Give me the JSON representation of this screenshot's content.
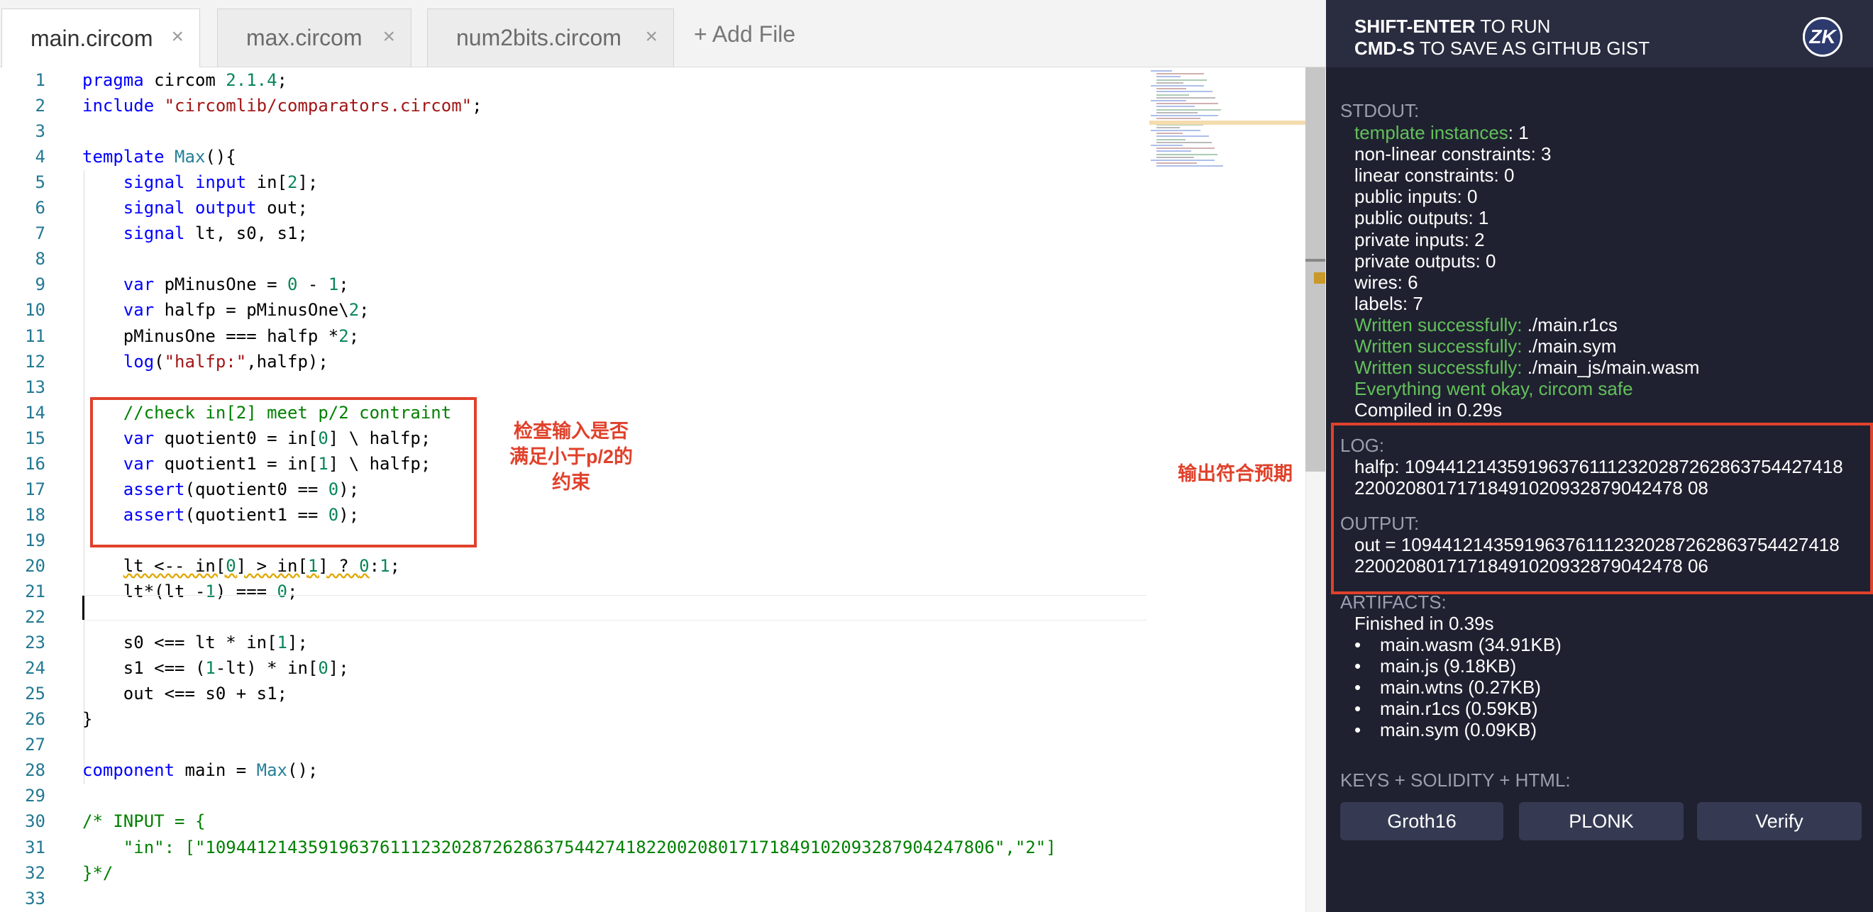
{
  "tabs": [
    {
      "label": "main.circom",
      "close": "×"
    },
    {
      "label": "max.circom",
      "close": "×"
    },
    {
      "label": "num2bits.circom",
      "close": "×"
    }
  ],
  "add_file": "+ Add File",
  "editor": {
    "line_numbers": [
      "1",
      "2",
      "3",
      "4",
      "5",
      "6",
      "7",
      "8",
      "9",
      "10",
      "11",
      "12",
      "13",
      "14",
      "15",
      "16",
      "17",
      "18",
      "19",
      "20",
      "21",
      "22",
      "23",
      "24",
      "25",
      "26",
      "27",
      "28",
      "29",
      "30",
      "31",
      "32",
      "33"
    ],
    "lines": [
      [
        {
          "t": "pragma",
          "c": "kw"
        },
        {
          "t": " circom "
        },
        {
          "t": "2.1.4",
          "c": "num"
        },
        {
          "t": ";"
        }
      ],
      [
        {
          "t": "include",
          "c": "kw"
        },
        {
          "t": " "
        },
        {
          "t": "\"circomlib/comparators.circom\"",
          "c": "str"
        },
        {
          "t": ";"
        }
      ],
      [],
      [
        {
          "t": "template",
          "c": "kw"
        },
        {
          "t": " "
        },
        {
          "t": "Max",
          "c": "ty"
        },
        {
          "t": "(){"
        }
      ],
      [
        {
          "t": "    "
        },
        {
          "t": "signal",
          "c": "kw"
        },
        {
          "t": " "
        },
        {
          "t": "input",
          "c": "kw"
        },
        {
          "t": " in["
        },
        {
          "t": "2",
          "c": "num"
        },
        {
          "t": "];"
        }
      ],
      [
        {
          "t": "    "
        },
        {
          "t": "signal",
          "c": "kw"
        },
        {
          "t": " "
        },
        {
          "t": "output",
          "c": "kw"
        },
        {
          "t": " out;"
        }
      ],
      [
        {
          "t": "    "
        },
        {
          "t": "signal",
          "c": "kw"
        },
        {
          "t": " lt, s0, s1;"
        }
      ],
      [],
      [
        {
          "t": "    "
        },
        {
          "t": "var",
          "c": "kw"
        },
        {
          "t": " pMinusOne = "
        },
        {
          "t": "0",
          "c": "num"
        },
        {
          "t": " - "
        },
        {
          "t": "1",
          "c": "num"
        },
        {
          "t": ";"
        }
      ],
      [
        {
          "t": "    "
        },
        {
          "t": "var",
          "c": "kw"
        },
        {
          "t": " halfp = pMinusOne\\"
        },
        {
          "t": "2",
          "c": "num"
        },
        {
          "t": ";"
        }
      ],
      [
        {
          "t": "    pMinusOne === halfp *"
        },
        {
          "t": "2",
          "c": "num"
        },
        {
          "t": ";"
        }
      ],
      [
        {
          "t": "    "
        },
        {
          "t": "log",
          "c": "kw"
        },
        {
          "t": "("
        },
        {
          "t": "\"halfp:\"",
          "c": "str"
        },
        {
          "t": ",halfp);"
        }
      ],
      [],
      [
        {
          "t": "    "
        },
        {
          "t": "//check in[2] meet p/2 contraint",
          "c": "cm"
        }
      ],
      [
        {
          "t": "    "
        },
        {
          "t": "var",
          "c": "kw"
        },
        {
          "t": " quotient0 = in["
        },
        {
          "t": "0",
          "c": "num"
        },
        {
          "t": "] \\ halfp;"
        }
      ],
      [
        {
          "t": "    "
        },
        {
          "t": "var",
          "c": "kw"
        },
        {
          "t": " quotient1 = in["
        },
        {
          "t": "1",
          "c": "num"
        },
        {
          "t": "] \\ halfp;"
        }
      ],
      [
        {
          "t": "    "
        },
        {
          "t": "assert",
          "c": "kw"
        },
        {
          "t": "(quotient0 == "
        },
        {
          "t": "0",
          "c": "num"
        },
        {
          "t": ");"
        }
      ],
      [
        {
          "t": "    "
        },
        {
          "t": "assert",
          "c": "kw"
        },
        {
          "t": "(quotient1 == "
        },
        {
          "t": "0",
          "c": "num"
        },
        {
          "t": ");"
        }
      ],
      [],
      [
        {
          "t": "    "
        },
        {
          "t": "lt <-- in[",
          "c": "sq"
        },
        {
          "t": "0",
          "c": "num sq"
        },
        {
          "t": "] > in[",
          "c": "sq"
        },
        {
          "t": "1",
          "c": "num sq"
        },
        {
          "t": "] ? ",
          "c": "sq"
        },
        {
          "t": "0",
          "c": "num sq"
        },
        {
          "t": ":"
        },
        {
          "t": "1",
          "c": "num"
        },
        {
          "t": ";"
        }
      ],
      [
        {
          "t": "    lt*(lt -"
        },
        {
          "t": "1",
          "c": "num"
        },
        {
          "t": ") === "
        },
        {
          "t": "0",
          "c": "num"
        },
        {
          "t": ";"
        }
      ],
      [],
      [
        {
          "t": "    s0 <== lt * in["
        },
        {
          "t": "1",
          "c": "num"
        },
        {
          "t": "];"
        }
      ],
      [
        {
          "t": "    s1 <== ("
        },
        {
          "t": "1",
          "c": "num"
        },
        {
          "t": "-lt) * in["
        },
        {
          "t": "0",
          "c": "num"
        },
        {
          "t": "];"
        }
      ],
      [
        {
          "t": "    out <== s0 + s1;"
        }
      ],
      [
        {
          "t": "}"
        }
      ],
      [],
      [
        {
          "t": "component",
          "c": "kw"
        },
        {
          "t": " main = "
        },
        {
          "t": "Max",
          "c": "ty"
        },
        {
          "t": "();"
        }
      ],
      [],
      [
        {
          "t": "/* INPUT = {",
          "c": "cm"
        }
      ],
      [
        {
          "t": "    \"in\": [\"10944121435919637611123202872628637544274182200208017171849102093287904247806\",\"2\"]",
          "c": "cm"
        }
      ],
      [
        {
          "t": "}*/",
          "c": "cm"
        }
      ],
      []
    ]
  },
  "annotations": {
    "left_note": [
      "检查输入是否",
      "满足小于p/2的",
      "约束"
    ],
    "right_note": "输出符合预期"
  },
  "panel": {
    "hint1_key": "SHIFT-ENTER",
    "hint1_rest": " TO RUN",
    "hint2_key": "CMD-S",
    "hint2_rest": " TO SAVE AS GITHUB GIST",
    "logo": "ZK",
    "stdout_label": "STDOUT:",
    "stdout": [
      {
        "g": "template instances",
        "r": ": 1"
      },
      {
        "r": "non-linear constraints: 3"
      },
      {
        "r": "linear constraints: 0"
      },
      {
        "r": "public inputs: 0"
      },
      {
        "r": "public outputs: 1"
      },
      {
        "r": "private inputs: 2"
      },
      {
        "r": "private outputs: 0"
      },
      {
        "r": "wires: 6"
      },
      {
        "r": "labels: 7"
      },
      {
        "g": "Written successfully:",
        "r": " ./main.r1cs"
      },
      {
        "g": "Written successfully:",
        "r": " ./main.sym"
      },
      {
        "g": "Written successfully:",
        "r": " ./main_js/main.wasm"
      },
      {
        "g": "Everything went okay, circom safe",
        "r": ""
      },
      {
        "r": "Compiled in 0.29s"
      }
    ],
    "log_label": "LOG:",
    "log_lines": [
      "halfp: 1094412143591963761112320287262863754427418",
      "22002080171718491020932879042478 08"
    ],
    "output_label": "OUTPUT:",
    "output_lines": [
      "out = 1094412143591963761112320287262863754427418",
      "22002080171718491020932879042478 06"
    ],
    "artifacts_label": "ARTIFACTS:",
    "finished": "Finished in 0.39s",
    "artifacts": [
      "main.wasm (34.91KB)",
      "main.js (9.18KB)",
      "main.wtns (0.27KB)",
      "main.r1cs (0.59KB)",
      "main.sym (0.09KB)"
    ],
    "keys_label": "KEYS + SOLIDITY + HTML:",
    "buttons": [
      "Groth16",
      "PLONK",
      "Verify"
    ]
  }
}
